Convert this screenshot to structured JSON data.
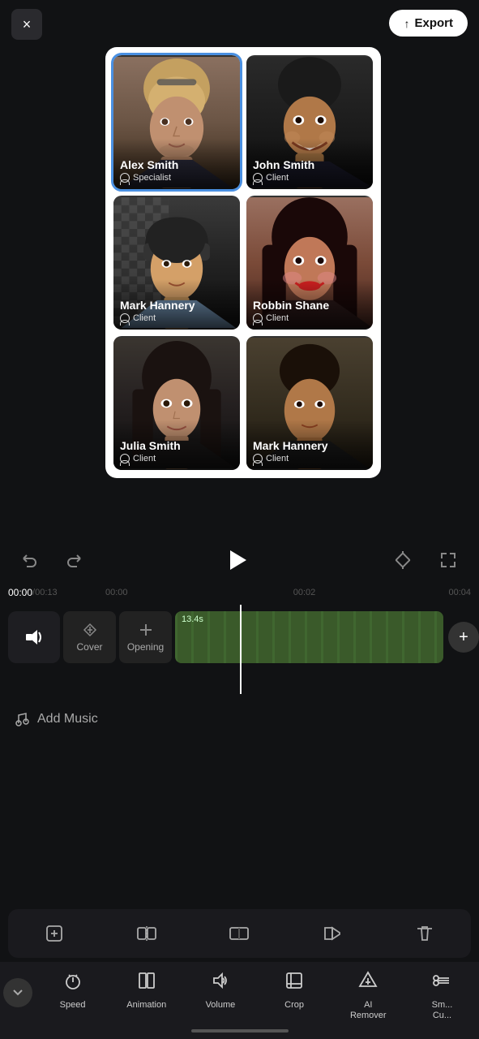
{
  "app": {
    "close_label": "×",
    "export_icon": "↑",
    "export_label": "Export"
  },
  "cards": [
    {
      "id": "alex-smith",
      "name": "Alex Smith",
      "role": "Specialist",
      "selected": true,
      "bg_top": "#8a7060",
      "bg_mid": "#6b5545",
      "bg_bot": "#4a3830",
      "hair": "#d4a060",
      "skin": "#c4906a"
    },
    {
      "id": "john-smith",
      "name": "John Smith",
      "role": "Client",
      "selected": false,
      "bg_top": "#2a2a2a",
      "bg_mid": "#1e1e1e",
      "bg_bot": "#111111",
      "hair": "#1a1a1a",
      "skin": "#b07a50"
    },
    {
      "id": "mark-hannery",
      "name": "Mark Hannery",
      "role": "Client",
      "selected": false,
      "bg_top": "#2a2a2a",
      "bg_mid": "#1a1a1a",
      "bg_bot": "#111111",
      "hair": "#111",
      "skin": "#d4a068"
    },
    {
      "id": "robbin-shane",
      "name": "Robbin Shane",
      "role": "Client",
      "selected": false,
      "bg_top": "#9a6050",
      "bg_mid": "#7a4030",
      "bg_bot": "#5a3020",
      "hair": "#1a0a0a",
      "skin": "#c07858"
    },
    {
      "id": "julia-smith",
      "name": "Julia Smith",
      "role": "Client",
      "selected": false,
      "bg_top": "#3a3a3a",
      "bg_mid": "#252525",
      "bg_bot": "#151515",
      "hair": "#1a1a1a",
      "skin": "#c09070"
    },
    {
      "id": "mark-hannery-2",
      "name": "Mark Hannery",
      "role": "Client",
      "selected": false,
      "bg_top": "#4a4535",
      "bg_mid": "#3a3525",
      "bg_bot": "#2a2515",
      "hair": "#2a1a0a",
      "skin": "#b87848"
    }
  ],
  "timeline": {
    "current_time": "00:00",
    "total_time": "00:13",
    "markers": [
      "00:00",
      "00:02",
      "00:04"
    ],
    "video_duration": "13.4s"
  },
  "tracks": {
    "cover_icon": "⟳",
    "cover_label": "Cover",
    "opening_icon": "+",
    "opening_label": "Opening",
    "add_icon": "+"
  },
  "add_music_label": "Add Music",
  "toolbar_icons": [
    "⊞",
    "⟦⟧",
    "⟧⟦",
    "⟨⟩",
    "🗑"
  ],
  "bottom_nav": [
    {
      "id": "speed",
      "label": "Speed",
      "icon": "⏱"
    },
    {
      "id": "animation",
      "label": "Animation",
      "icon": "▣"
    },
    {
      "id": "volume",
      "label": "Volume",
      "icon": "🔊"
    },
    {
      "id": "crop",
      "label": "Crop",
      "icon": "⊡"
    },
    {
      "id": "ai-remover",
      "label": "AI\nRemover",
      "icon": "◈"
    },
    {
      "id": "smart-cut",
      "label": "Sm...\nCu...",
      "icon": "✂"
    }
  ],
  "collapse_icon": "∨"
}
